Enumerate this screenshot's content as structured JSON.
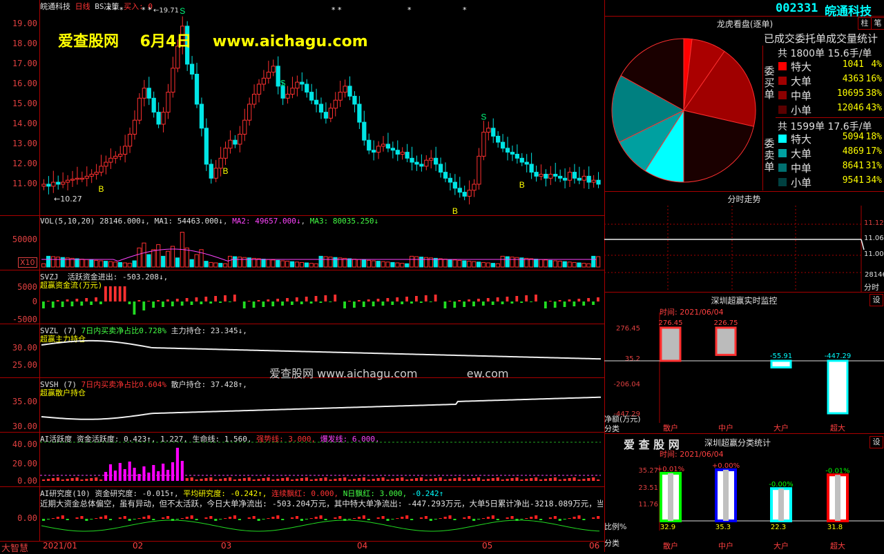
{
  "top_bar": {
    "stock_name": "皖通科技",
    "period": "日线",
    "strategy": "BS决策",
    "buy_marker": "买入: 0",
    "stars": [
      "* * *",
      "* *",
      "* *",
      "*",
      "*",
      "* *",
      "* * *"
    ],
    "max_marker": "19.71"
  },
  "watermark": {
    "site": "爱查股网",
    "date": "6月4日",
    "url": "www.aichagu.com",
    "mid_text": "爱查股网 www.aichagu.com",
    "mid_text_tail": "ew.com"
  },
  "price_pane": {
    "ticks": [
      "19.00",
      "18.00",
      "17.00",
      "16.00",
      "15.00",
      "14.00",
      "13.00",
      "12.00",
      "11.00"
    ],
    "min_label": "10.27",
    "signals": [
      "B",
      "S",
      "B",
      "S",
      "B",
      "S",
      "B"
    ]
  },
  "vol_pane": {
    "header": "VOL(5,10,20)",
    "vol": "28146.000↓",
    "ma1": "MA1: 54463.000↓",
    "ma2": "MA2: 49657.000↓",
    "ma3": "MA3: 80035.250↓",
    "ticks": [
      "50000"
    ],
    "unit": "X10"
  },
  "svzj_pane": {
    "code": "SVZJ",
    "label": "活跃资金进出: -503.208↓,",
    "sub": "超赢资金流(万元)",
    "ticks": [
      "5000",
      "0",
      "-5000"
    ]
  },
  "svzl_pane": {
    "code": "SVZL",
    "param": "(7)",
    "label1": "7日内买卖净占比0.728%",
    "label2": "主力持仓: 23.345↓,",
    "sub": "超赢主力持仓",
    "ticks": [
      "30.00",
      "25.00"
    ]
  },
  "svsh_pane": {
    "code": "SVSH",
    "param": "(7)",
    "label1": "7日内买卖净占比0.604%",
    "label2": "散户持仓: 37.428↑,",
    "sub": "超赢散户持仓",
    "ticks": [
      "35.00",
      "30.00"
    ]
  },
  "ai_pane": {
    "label": "AI活跃度",
    "a": "资金活跃度: 0.423↑, 1.227,",
    "b": "生命线: 1.560,",
    "c": "强势线: 3.000,",
    "d": "爆发线: 6.000,",
    "ticks": [
      "40.00",
      "20.00",
      "0.00"
    ]
  },
  "research_pane": {
    "label": "AI研究度(10)",
    "a": "资金研究度: -0.015↑,",
    "b": "平均研究度: -0.242↑,",
    "c": "连续飘红: 0.000,",
    "d": "N日飘红: 3.000,",
    "e": "-0.242↑",
    "note": "近期大资金总体偏空，虽有异动，但不太活跃，今日大单净流出: -503.204万元，其中特大单净流出: -447.293万元，大单5日累计净出-3218.089万元，当前",
    "ticks": [
      "0.00"
    ]
  },
  "bottom": {
    "label": "大智慧",
    "dates": [
      "2021/01",
      "02",
      "03",
      "04",
      "05",
      "06"
    ]
  },
  "right": {
    "code": "002331",
    "name": "皖通科技",
    "btn1": "柱",
    "btn2": "笔",
    "lhb_title": "龙虎看盘(逐单)",
    "lhb_sub": "已成交委托单成交量统计",
    "buy": {
      "side": "委买单",
      "total": "共 1800单 15.6手/单",
      "rows": [
        {
          "name": "特大",
          "vol": "1041",
          "pct": "4%",
          "color": "#ff0000"
        },
        {
          "name": "大单",
          "vol": "4363",
          "pct": "16%",
          "color": "#a00000"
        },
        {
          "name": "中单",
          "vol": "10695",
          "pct": "38%",
          "color": "#8b0000"
        },
        {
          "name": "小单",
          "vol": "12046",
          "pct": "43%",
          "color": "#5a0000"
        }
      ]
    },
    "sell": {
      "side": "委卖单",
      "total": "共 1599单 17.6手/单",
      "rows": [
        {
          "name": "特大",
          "vol": "5094",
          "pct": "18%",
          "color": "#00ffff"
        },
        {
          "name": "大单",
          "vol": "4869",
          "pct": "17%",
          "color": "#00a0a0"
        },
        {
          "name": "中单",
          "vol": "8641",
          "pct": "31%",
          "color": "#007070"
        },
        {
          "name": "小单",
          "vol": "9541",
          "pct": "34%",
          "color": "#004040"
        }
      ]
    },
    "fs_title": "分时走势",
    "fs_ticks": [
      "11.12",
      "11.06",
      "11.00",
      "28146"
    ],
    "fs_unit": "分时",
    "mon_title": "深圳超赢实时监控",
    "mon_btn": "设",
    "mon_time": "时间: 2021/06/04",
    "mon_ticks": [
      "276.45",
      "35.2",
      "-206.04",
      "-447.29"
    ],
    "mon_ylabel": "净额(万元)",
    "mon_xlabel": "分类",
    "mon_bars": [
      {
        "name": "散户",
        "value": 276.45,
        "label": "276.45"
      },
      {
        "name": "中户",
        "value": 226.75,
        "label": "226.75"
      },
      {
        "name": "大户",
        "value": -55.91,
        "label": "-55.91"
      },
      {
        "name": "超大",
        "value": -447.29,
        "label": "-447.29"
      }
    ],
    "cls_logo": "爱 查 股 网",
    "cls_title": "深圳超赢分类统计",
    "cls_btn": "设",
    "cls_time": "时间: 2021/06/04",
    "cls_ticks": [
      "35.27",
      "23.51",
      "11.76"
    ],
    "cls_ylabel": "比例%",
    "cls_xlabel": "分类",
    "cls_bars": [
      {
        "name": "散户",
        "value": 32.9,
        "delta": "+0.01%",
        "label": "32.9",
        "color": "#00ff00"
      },
      {
        "name": "中户",
        "value": 35.3,
        "delta": "+0.00%",
        "label": "35.3",
        "color": "#0000ff"
      },
      {
        "name": "大户",
        "value": 22.3,
        "delta": "-0.00%",
        "label": "22.3",
        "color": "#00ffff"
      },
      {
        "name": "超大",
        "value": 31.8,
        "delta": "-0.01%",
        "label": "31.8",
        "color": "#ff0000"
      }
    ]
  },
  "colors": {
    "up": "#ff3030",
    "down": "#00e5e5",
    "grid": "#aa0000",
    "text": "#c0c0c0"
  }
}
